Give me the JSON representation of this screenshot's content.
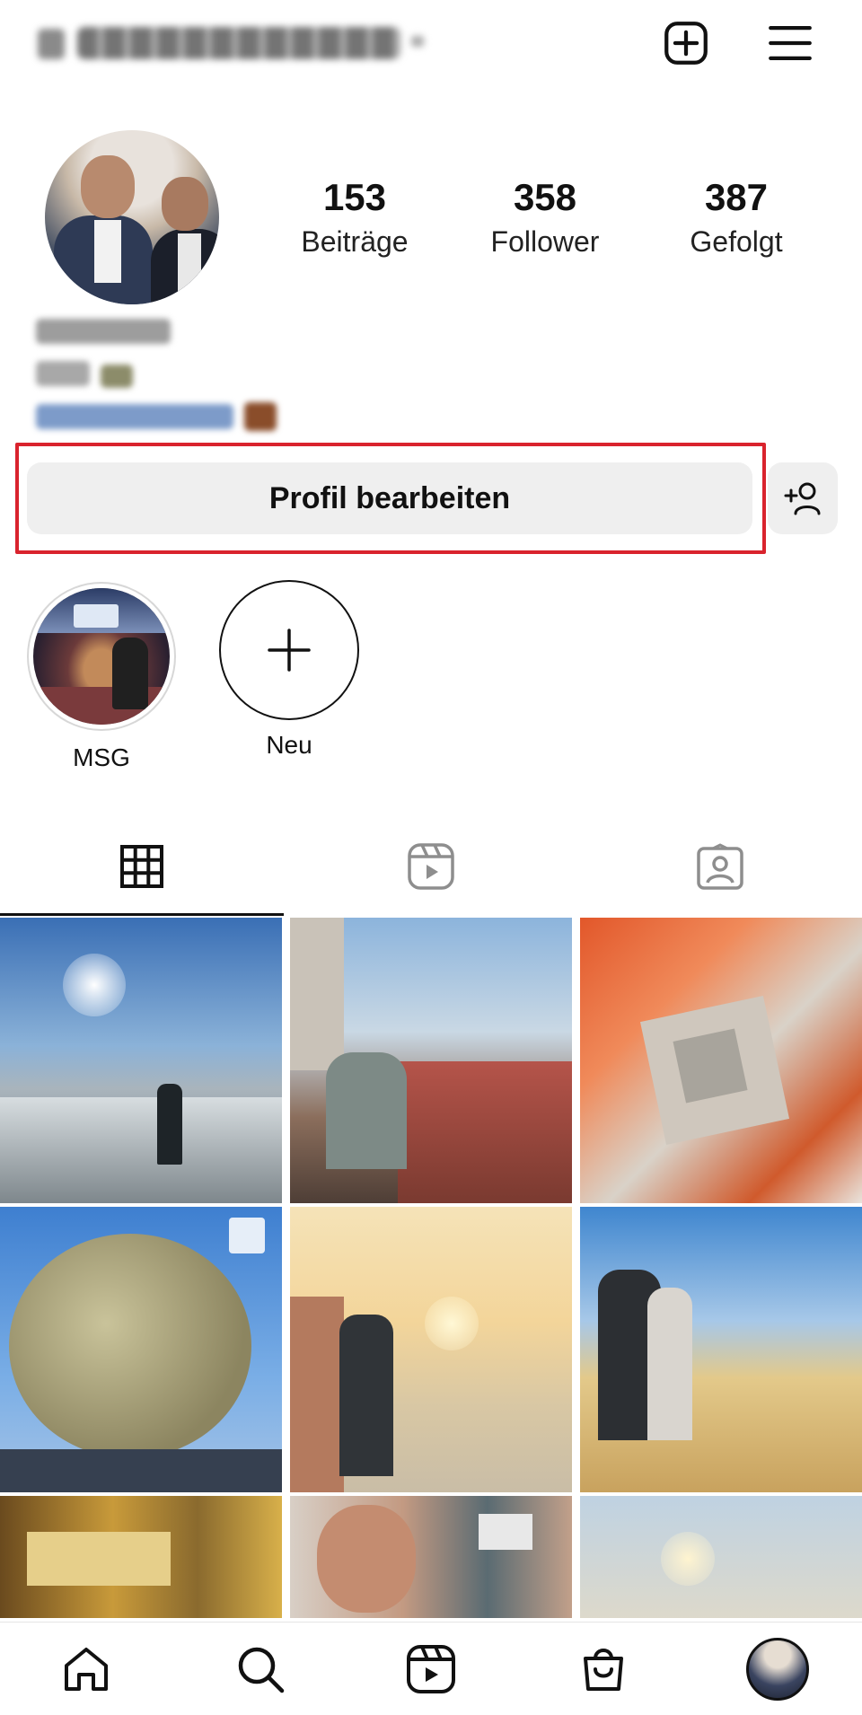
{
  "header": {
    "username": "derhansemann",
    "new_post_icon": "plus-square-icon",
    "menu_icon": "hamburger-menu-icon"
  },
  "profile": {
    "stats": [
      {
        "value": "153",
        "label": "Beiträge"
      },
      {
        "value": "358",
        "label": "Follower"
      },
      {
        "value": "387",
        "label": "Gefolgt"
      }
    ],
    "bio_name": "Johannes"
  },
  "actions": {
    "edit_profile_label": "Profil bearbeiten",
    "discover_people_icon": "add-person-icon",
    "highlight_color": "#d9232d"
  },
  "highlights": [
    {
      "label": "MSG"
    },
    {
      "label": "Neu"
    }
  ],
  "tabs": [
    {
      "icon": "grid-icon",
      "active": true
    },
    {
      "icon": "reels-icon",
      "active": false
    },
    {
      "icon": "tagged-icon",
      "active": false
    }
  ],
  "bottom_nav": [
    {
      "icon": "home-icon"
    },
    {
      "icon": "search-icon"
    },
    {
      "icon": "reels-icon"
    },
    {
      "icon": "shop-icon"
    },
    {
      "icon": "profile-avatar"
    }
  ]
}
